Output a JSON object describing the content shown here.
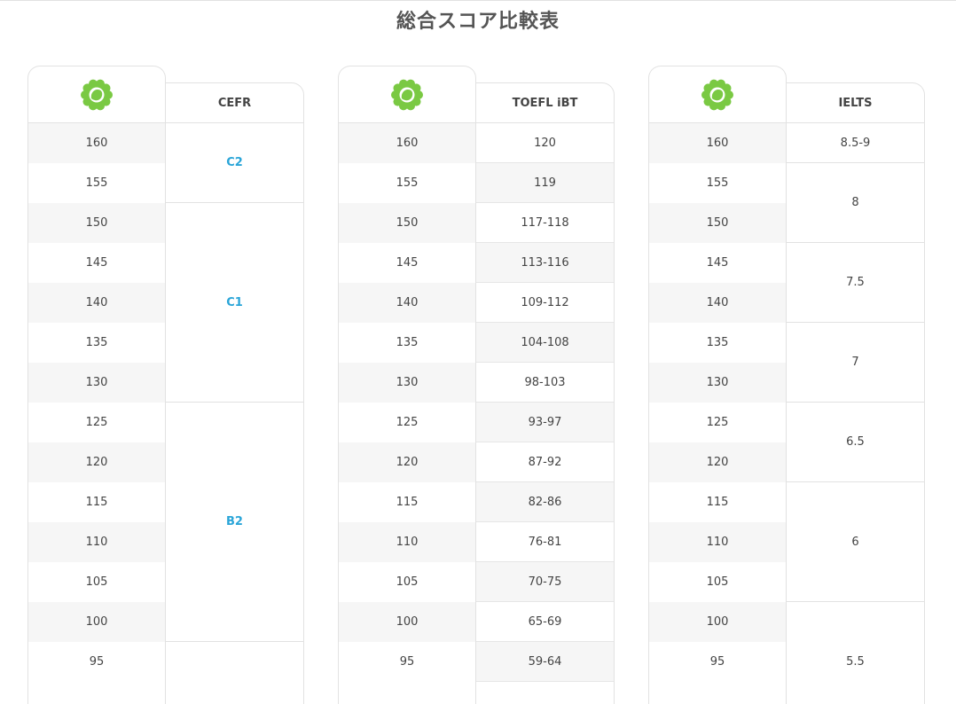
{
  "title": "総合スコア比較表",
  "scores": [
    "160",
    "155",
    "150",
    "145",
    "140",
    "135",
    "130",
    "125",
    "120",
    "115",
    "110",
    "105",
    "100",
    "95"
  ],
  "colors": {
    "cefr": "#2aa5d8",
    "logo": "#7ac943"
  },
  "tables": [
    {
      "logo_icon": "green-flower-logo-icon",
      "header": "CEFR",
      "spans": [
        {
          "label": "C2",
          "rows": 2
        },
        {
          "label": "C1",
          "rows": 5
        },
        {
          "label": "B2",
          "rows": 6
        },
        {
          "label": "",
          "rows": 2
        }
      ]
    },
    {
      "logo_icon": "green-flower-logo-icon",
      "header": "TOEFL iBT",
      "values": [
        "120",
        "119",
        "117-118",
        "113-116",
        "109-112",
        "104-108",
        "98-103",
        "93-97",
        "87-92",
        "82-86",
        "76-81",
        "70-75",
        "65-69",
        "59-64"
      ]
    },
    {
      "logo_icon": "green-flower-logo-icon",
      "header": "IELTS",
      "spans": [
        {
          "label": "8.5-9",
          "rows": 1
        },
        {
          "label": "8",
          "rows": 2
        },
        {
          "label": "7.5",
          "rows": 2
        },
        {
          "label": "7",
          "rows": 2
        },
        {
          "label": "6.5",
          "rows": 2
        },
        {
          "label": "6",
          "rows": 3
        },
        {
          "label": "5.5",
          "rows": 3
        }
      ]
    }
  ]
}
